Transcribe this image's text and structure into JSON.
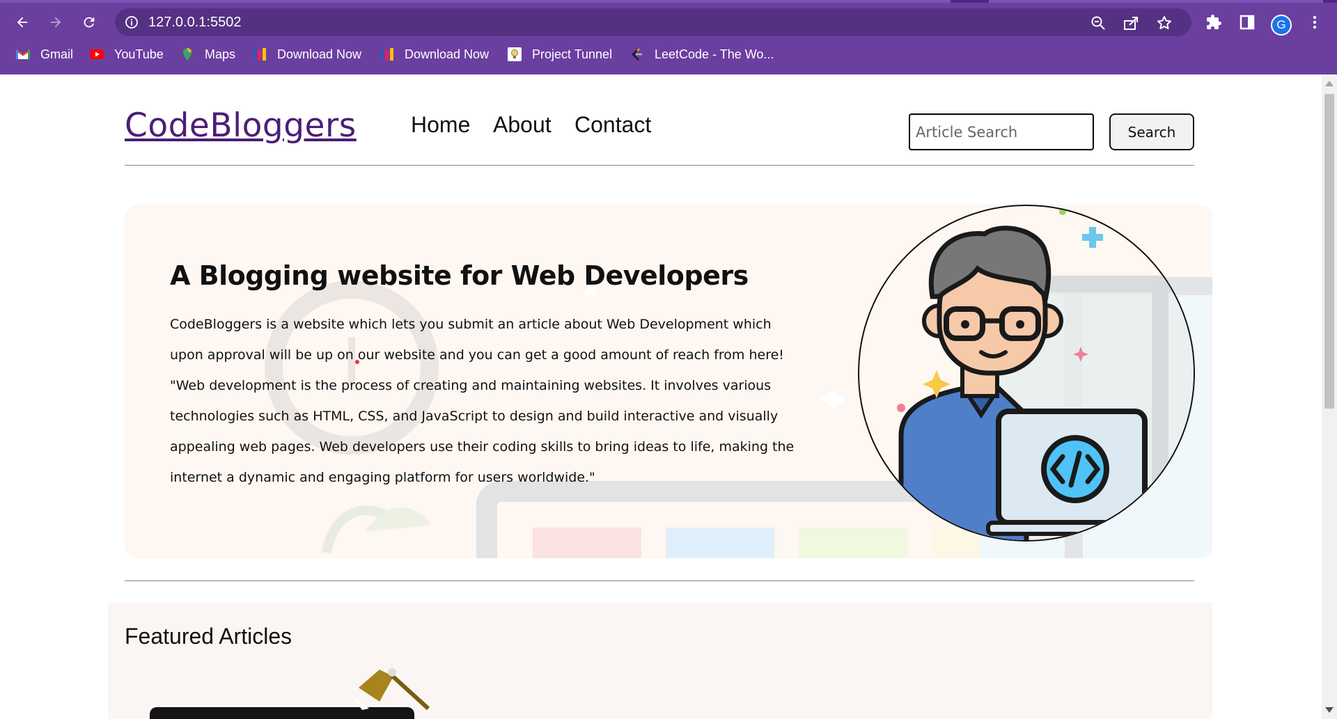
{
  "browser": {
    "url": "127.0.0.1:5502",
    "profile_initial": "G",
    "toolbar_icons": [
      "back-icon",
      "forward-icon",
      "reload-icon",
      "info-icon",
      "zoom-icon",
      "share-icon",
      "star-icon",
      "extensions-icon",
      "side-panel-icon",
      "menu-icon"
    ],
    "bookmarks": [
      {
        "label": "Gmail",
        "icon": "gmail-icon"
      },
      {
        "label": "YouTube",
        "icon": "youtube-icon"
      },
      {
        "label": "Maps",
        "icon": "maps-icon"
      },
      {
        "label": "Download Now",
        "icon": "download-icon"
      },
      {
        "label": "Download Now",
        "icon": "download-icon"
      },
      {
        "label": "Project Tunnel",
        "icon": "project-tunnel-icon"
      },
      {
        "label": "LeetCode - The Wo...",
        "icon": "leetcode-icon"
      }
    ]
  },
  "site": {
    "logo": "CodeBloggers",
    "nav": [
      "Home",
      "About",
      "Contact"
    ],
    "search": {
      "placeholder": "Article Search",
      "button_label": "Search"
    }
  },
  "hero": {
    "title": "A Blogging website for Web Developers",
    "paragraph_1": "CodeBloggers is a website which lets you submit an article about Web Development which upon approval will be up on our website and you can get a good amount of reach from here!",
    "paragraph_2": "\"Web development is the process of creating and maintaining websites. It involves various technologies such as HTML, CSS, and JavaScript to design and build interactive and visually appealing web pages. Web developers use their coding skills to bring ideas to life, making the internet a dynamic and engaging platform for users worldwide.\""
  },
  "featured": {
    "title": "Featured Articles"
  },
  "colors": {
    "chrome": "#6b3fa0",
    "logo": "#4b1e77",
    "hero_bg": "#fef7f2"
  }
}
